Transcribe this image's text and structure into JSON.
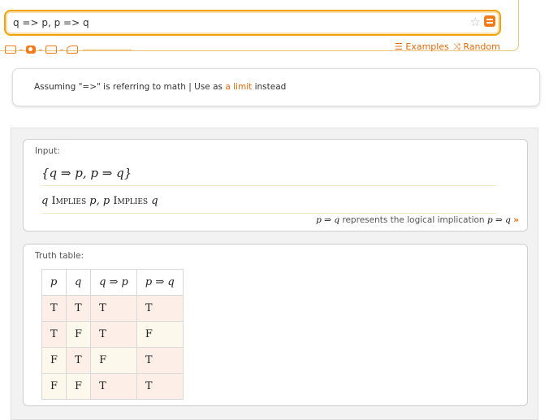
{
  "search": {
    "query": "q => p, p => q"
  },
  "links": {
    "examples": "Examples",
    "random": "Random"
  },
  "assuming": {
    "prefix": "Assuming \"=>\" is referring to math | Use as ",
    "link": "a limit",
    "suffix": " instead"
  },
  "input_pod": {
    "title": "Input:",
    "set_expr": "{q ⇒ p, p ⇒ q}",
    "words": {
      "q1": "q",
      "implies1": "Implies",
      "p1": "p,",
      "p2": "p",
      "implies2": "Implies",
      "q2": "q"
    },
    "note_expr": "p ⇒ q",
    "note_text": "represents the logical implication",
    "note_expr2": "p ⇒ q",
    "note_more": "»"
  },
  "truth_pod": {
    "title": "Truth table:",
    "headers": [
      "p",
      "q",
      "q ⇒ p",
      "p ⇒ q"
    ],
    "rows": [
      [
        "T",
        "T",
        "T",
        "T"
      ],
      [
        "T",
        "F",
        "T",
        "F"
      ],
      [
        "F",
        "T",
        "F",
        "T"
      ],
      [
        "F",
        "F",
        "T",
        "T"
      ]
    ]
  },
  "colors": {
    "accent": "#f07d1a",
    "link": "#e06a0a"
  },
  "icons": [
    "star-icon",
    "equals-icon",
    "keyboard-icon",
    "camera-icon",
    "table-icon",
    "shapes-icon",
    "list-icon",
    "shuffle-icon"
  ]
}
